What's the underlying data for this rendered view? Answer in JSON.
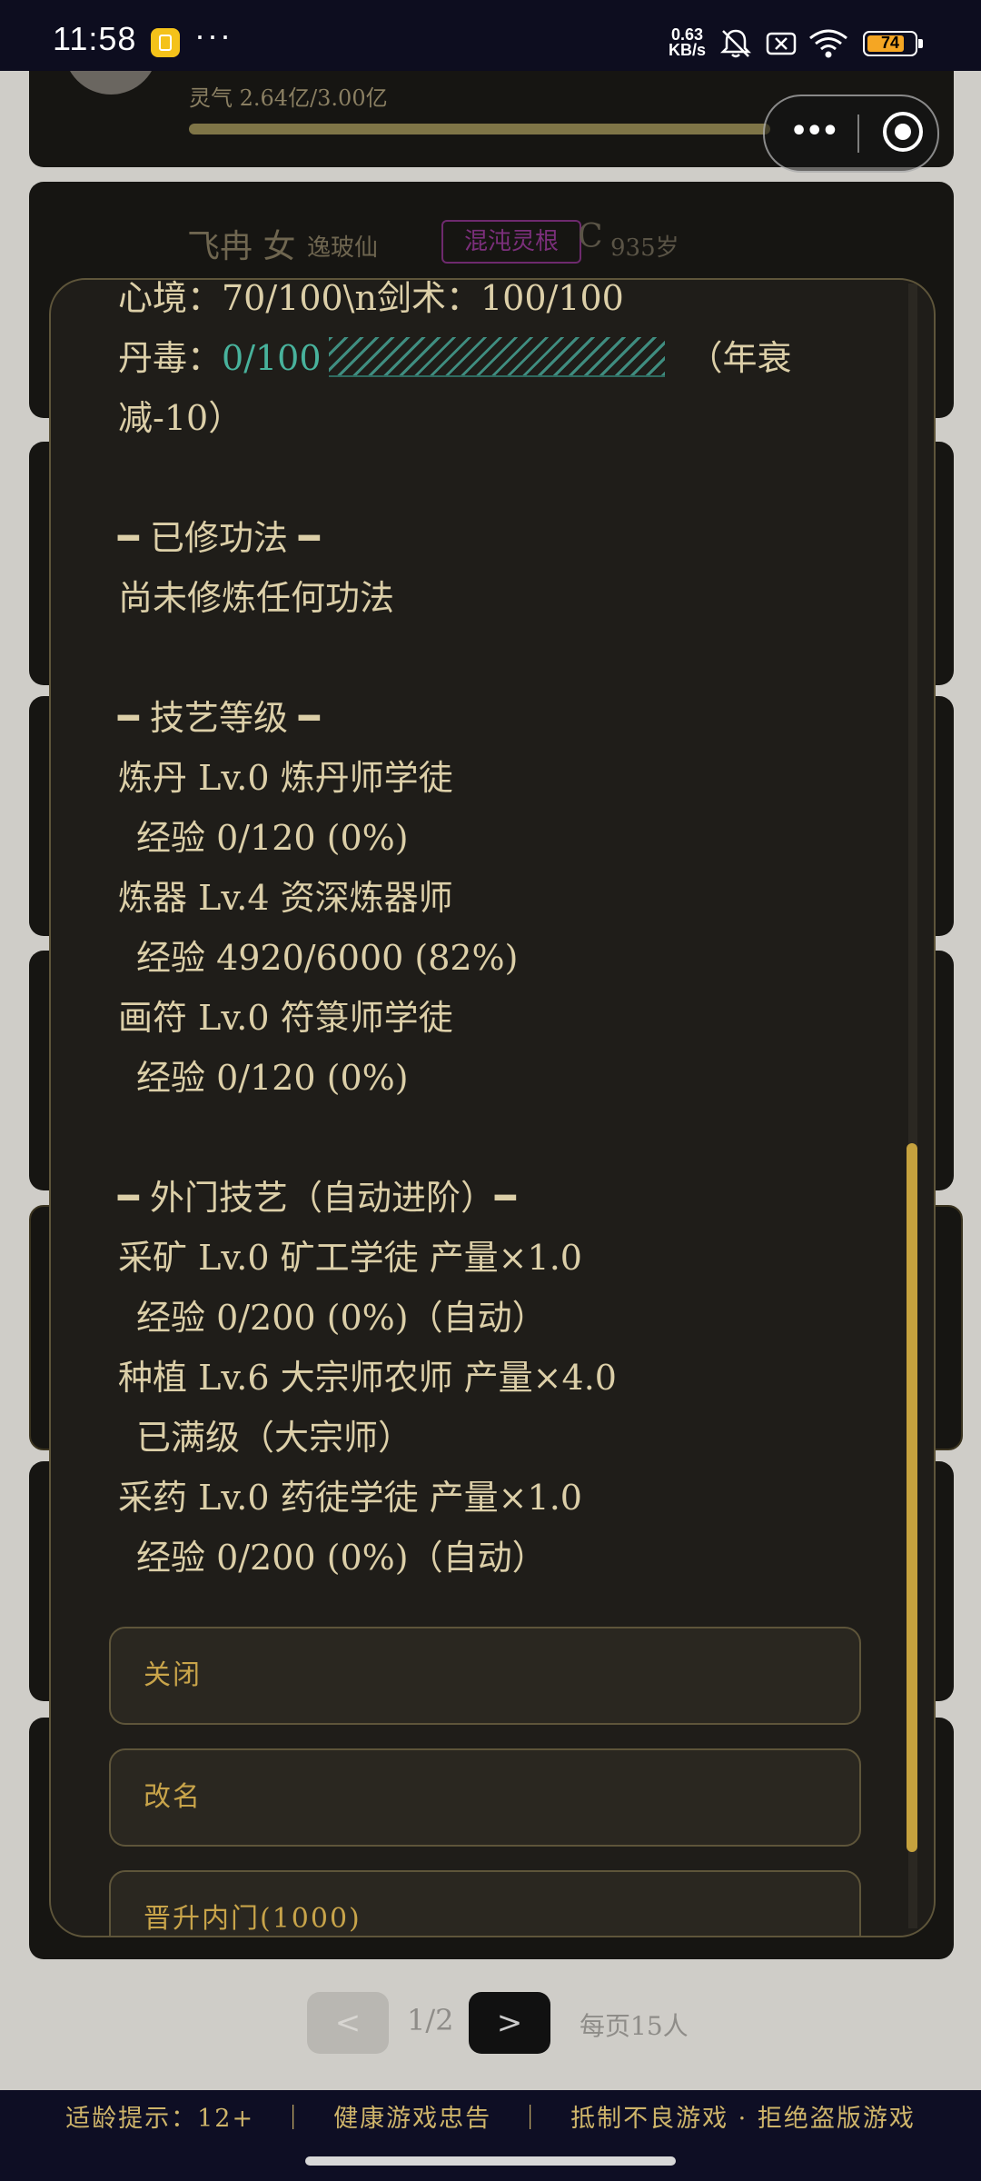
{
  "status_bar": {
    "time": "11:58",
    "more": "···",
    "net_speed": "0.63",
    "net_unit": "KB/s",
    "battery": "74"
  },
  "background": {
    "card1_qi": "灵气 2.64亿/3.00亿",
    "card2_name": "飞冉 女",
    "card2_rank": "逸玻仙",
    "card2_root": "混沌灵根",
    "card2_grade": "C",
    "card2_age": "935岁"
  },
  "modal": {
    "lines": [
      "心境：70/100\\n剑术：100/100",
      "丹毒：",
      "0/100",
      "（年衰",
      "减-10）",
      "━ 已修功法 ━",
      "尚未修炼任何功法",
      "━ 技艺等级 ━",
      "炼丹 Lv.0 炼丹师学徒",
      "经验 0/120 (0%)",
      "炼器 Lv.4 资深炼器师",
      "经验 4920/6000 (82%)",
      "画符 Lv.0 符箓师学徒",
      "经验 0/120 (0%)",
      "━ 外门技艺（自动进阶）━",
      "采矿 Lv.0 矿工学徒 产量×1.0",
      "经验 0/200 (0%)（自动）",
      "种植 Lv.6 大宗师农师 产量×4.0",
      "已满级（大宗师）",
      "采药 Lv.0 药徒学徒 产量×1.0",
      "经验 0/200 (0%)（自动）"
    ],
    "dan_poison_fraction": 0,
    "buttons": {
      "close": "关闭",
      "rename": "改名",
      "promote": "晋升内门(1000)"
    }
  },
  "pagination": {
    "prev": "<",
    "page": "1/2",
    "next": ">",
    "per_page": "每页15人"
  },
  "footer": {
    "text": "适龄提示：12+　｜　健康游戏忠告　｜　抵制不良游戏 · 拒绝盗版游戏"
  },
  "colors": {
    "accent_gold": "#c6a23e",
    "teal": "#48b29c",
    "modal_bg": "#1f1d19"
  }
}
